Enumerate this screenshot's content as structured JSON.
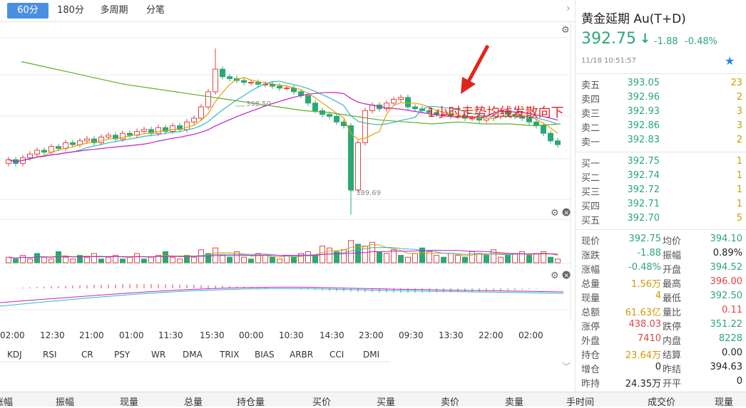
{
  "tabs": {
    "items": [
      "60分",
      "180分",
      "多周期",
      "分笔"
    ],
    "active_index": 0
  },
  "chart": {
    "annotation": "1小时走势均线发散向下",
    "high_label": "398.50",
    "low_label": "389.69",
    "time_labels": [
      "02:00",
      "12:30",
      "21:00",
      "01:00",
      "11:30",
      "15:30",
      "00:00",
      "10:30",
      "14:30",
      "23:00",
      "09:30",
      "13:30",
      "22:00",
      "02:00"
    ],
    "indicator_tabs": [
      "KDJ",
      "RSI",
      "CR",
      "PSY",
      "WR",
      "DMA",
      "TRIX",
      "BIAS",
      "ARBR",
      "CCI",
      "DMI"
    ],
    "colors": {
      "up": "#e34545",
      "down": "#2aa876",
      "ma1": "#e2a100",
      "ma2": "#33b5c8",
      "ma3": "#c21fc2",
      "ma4": "#5fae2a"
    }
  },
  "chart_data": {
    "type": "candlestick",
    "high": 398.5,
    "low": 389.69
  },
  "quote": {
    "name": "黄金延期 Au(T+D)",
    "price": "392.75",
    "arrow": "↓",
    "change": "-1.88",
    "change_pct": "-0.48%",
    "time": "11/18  10:51:57",
    "favorite_icon": "star-icon"
  },
  "order_book": {
    "asks": [
      {
        "label": "卖五",
        "price": "393.05",
        "vol": "23"
      },
      {
        "label": "卖四",
        "price": "392.96",
        "vol": "2"
      },
      {
        "label": "卖三",
        "price": "392.93",
        "vol": "3"
      },
      {
        "label": "卖二",
        "price": "392.86",
        "vol": "3"
      },
      {
        "label": "卖一",
        "price": "392.83",
        "vol": "2"
      }
    ],
    "bids": [
      {
        "label": "买一",
        "price": "392.75",
        "vol": "1"
      },
      {
        "label": "买二",
        "price": "392.74",
        "vol": "1"
      },
      {
        "label": "买三",
        "price": "392.72",
        "vol": "1"
      },
      {
        "label": "买四",
        "price": "392.71",
        "vol": "1"
      },
      {
        "label": "买五",
        "price": "392.70",
        "vol": "5"
      }
    ]
  },
  "stats": [
    {
      "l1": "现价",
      "v1": "392.75",
      "c1": "green",
      "l2": "均价",
      "v2": "394.10",
      "c2": "green"
    },
    {
      "l1": "涨跌",
      "v1": "-1.88",
      "c1": "green",
      "l2": "振幅",
      "v2": "0.89%",
      "c2": "dark"
    },
    {
      "l1": "涨幅",
      "v1": "-0.48%",
      "c1": "green",
      "l2": "开盘",
      "v2": "394.52",
      "c2": "green"
    },
    {
      "l1": "总量",
      "v1": "1.56万",
      "c1": "orange",
      "l2": "最高",
      "v2": "396.00",
      "c2": "red"
    },
    {
      "l1": "现量",
      "v1": "4",
      "c1": "orange",
      "l2": "最低",
      "v2": "392.50",
      "c2": "green"
    },
    {
      "l1": "总额",
      "v1": "61.63亿",
      "c1": "orange",
      "l2": "量比",
      "v2": "0.11",
      "c2": "red"
    },
    {
      "l1": "涨停",
      "v1": "438.03",
      "c1": "red",
      "l2": "跌停",
      "v2": "351.22",
      "c2": "green"
    },
    {
      "l1": "外盘",
      "v1": "7410",
      "c1": "red",
      "l2": "内盘",
      "v2": "8228",
      "c2": "green"
    },
    {
      "l1": "持仓",
      "v1": "23.64万",
      "c1": "orange",
      "l2": "结算",
      "v2": "0.00",
      "c2": "dark"
    },
    {
      "l1": "增仓",
      "v1": "0",
      "c1": "dark",
      "l2": "昨结",
      "v2": "394.63",
      "c2": "dark"
    },
    {
      "l1": "昨持",
      "v1": "24.35万",
      "c1": "dark",
      "l2": "开平",
      "v2": "0",
      "c2": "dark"
    }
  ],
  "bottom_headers": [
    "涨幅",
    "振幅",
    "现量",
    "总量",
    "持仓量",
    "买价",
    "买量",
    "卖价",
    "卖量",
    "手时间",
    "成交价",
    "现量"
  ]
}
